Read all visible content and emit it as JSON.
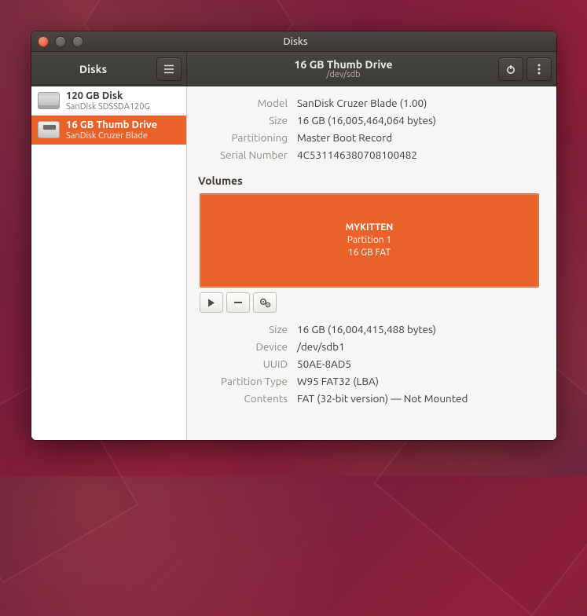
{
  "window": {
    "title": "Disks"
  },
  "header": {
    "sidebar_title": "Disks",
    "title": "16 GB Thumb Drive",
    "subtitle": "/dev/sdb"
  },
  "sidebar": {
    "drives": [
      {
        "name": "120 GB Disk",
        "sub": "SanDisk SDSSDA120G",
        "kind": "hdd",
        "selected": false
      },
      {
        "name": "16 GB Thumb Drive",
        "sub": "SanDisk Cruzer Blade",
        "kind": "usb",
        "selected": true
      }
    ]
  },
  "disk": {
    "labels": {
      "model": "Model",
      "size": "Size",
      "partitioning": "Partitioning",
      "serial": "Serial Number"
    },
    "model": "SanDisk Cruzer Blade (1.00)",
    "size": "16 GB (16,005,464,064 bytes)",
    "partitioning": "Master Boot Record",
    "serial": "4C531146380708100482"
  },
  "volumes": {
    "heading": "Volumes",
    "block": {
      "name": "MYKITTEN",
      "line2": "Partition 1",
      "line3": "16 GB FAT"
    }
  },
  "partition": {
    "labels": {
      "size": "Size",
      "device": "Device",
      "uuid": "UUID",
      "ptype": "Partition Type",
      "contents": "Contents"
    },
    "size": "16 GB (16,004,415,488 bytes)",
    "device": "/dev/sdb1",
    "uuid": "50AE-8AD5",
    "ptype": "W95 FAT32 (LBA)",
    "contents": "FAT (32-bit version) — Not Mounted"
  }
}
